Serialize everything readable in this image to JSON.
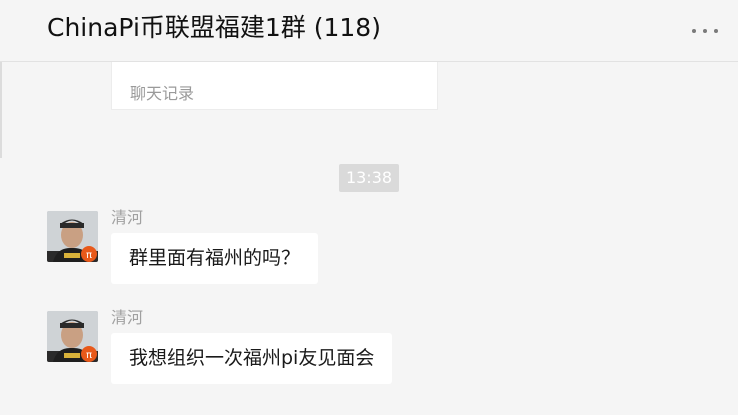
{
  "header": {
    "title": "ChinaPi币联盟福建1群 (118)",
    "more_icon": "more-dots-icon"
  },
  "history_card": {
    "label": "聊天记录"
  },
  "timestamp": "13:38",
  "messages": [
    {
      "sender": "清河",
      "text": "群里面有福州的吗？",
      "avatar": "avatar-pi-badge"
    },
    {
      "sender": "清河",
      "text": "我想组织一次福州pi友见面会",
      "avatar": "avatar-pi-badge"
    }
  ],
  "colors": {
    "background": "#f5f5f5",
    "bubble": "#ffffff",
    "timestamp_bg": "#dadada",
    "badge": "#e8591a"
  }
}
